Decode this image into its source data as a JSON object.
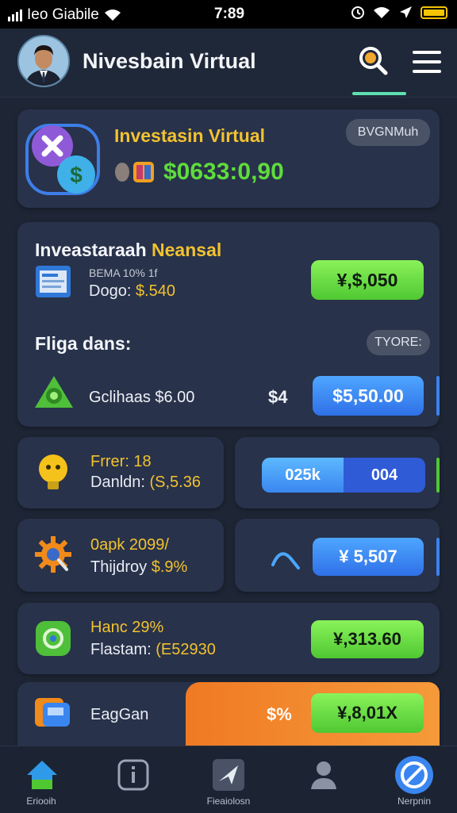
{
  "status_bar": {
    "carrier": "Ieo Giabile",
    "time": "7:89"
  },
  "header": {
    "title": "Nivesbain Virtual"
  },
  "summary_card": {
    "title": "Investasin Virtual",
    "badge": "BVGNMuh",
    "amount": "$0633:0,90"
  },
  "portfolio_card": {
    "title_part1": "Inveastaraah",
    "title_part2": "Neansal",
    "item_line1": "BEMA 10% 1f",
    "item_line2_label": "Dogo:",
    "item_line2_value": "$.540",
    "item_value": "¥,$,050",
    "section_title": "Fliga dans:",
    "section_tag": "TYORE:",
    "row_label": "Gclihaas $6.00",
    "row_amount": "$4",
    "row_value": "$5,50.00"
  },
  "tile_a": {
    "line1": "Frrer: 18",
    "line2_label": "Danldn:",
    "line2_value": "(S,5.36"
  },
  "tile_b": {
    "left": "025k",
    "right": "004"
  },
  "tile_c": {
    "line1": "0apk 2099/",
    "line2_label": "Thijdroy",
    "line2_value": "$.9%"
  },
  "tile_d": {
    "value": "¥ 5,507"
  },
  "row_e": {
    "line1": "Hanc 29%",
    "line2_label": "Flastam:",
    "line2_value": "(E52930",
    "value": "¥,313.60"
  },
  "row_f": {
    "label": "EagGan",
    "percent": "$%",
    "value": "¥,8,01X"
  },
  "nav": {
    "items": [
      {
        "label": "Eriooih"
      },
      {
        "label": ""
      },
      {
        "label": "Fieaiolosn"
      },
      {
        "label": ""
      },
      {
        "label": "Nerpnin"
      }
    ]
  },
  "colors": {
    "accent_green": "#4fc832",
    "accent_blue": "#2f70e8",
    "accent_yellow": "#f2c230",
    "accent_orange": "#f07a24",
    "background": "#1e2636",
    "card": "#28324a"
  }
}
